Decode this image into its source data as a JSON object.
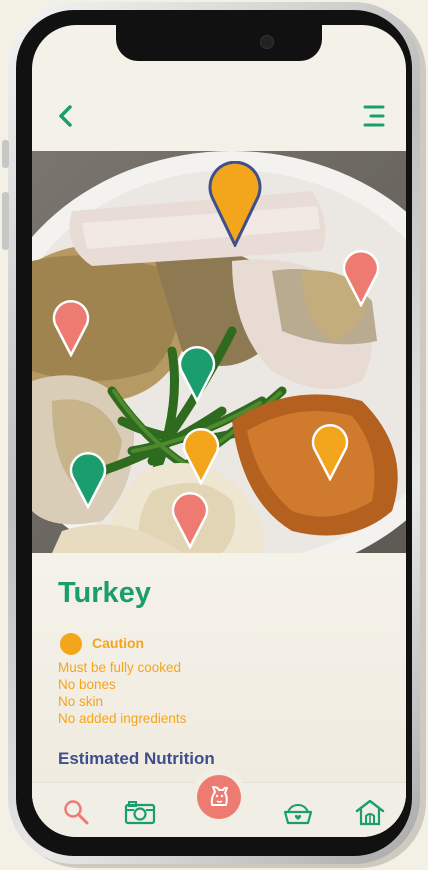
{
  "food": {
    "name": "Turkey",
    "status": "Caution",
    "status_color": "#f3a51c",
    "notes": [
      "Must be fully cooked",
      "No bones",
      "No skin",
      "No added ingredients"
    ]
  },
  "sections": {
    "nutrition_title": "Estimated Nutrition"
  },
  "header": {
    "back_icon": "chevron-left-icon",
    "menu_icon": "menu-icon"
  },
  "pins": {
    "colors": {
      "caution": "#f3a51c",
      "safe": "#1b9e6e",
      "avoid": "#ee7b72"
    }
  },
  "bottom_nav": {
    "items": [
      "search-icon",
      "camera-icon",
      "dog-icon",
      "food-bowl-icon",
      "kennel-icon"
    ]
  }
}
